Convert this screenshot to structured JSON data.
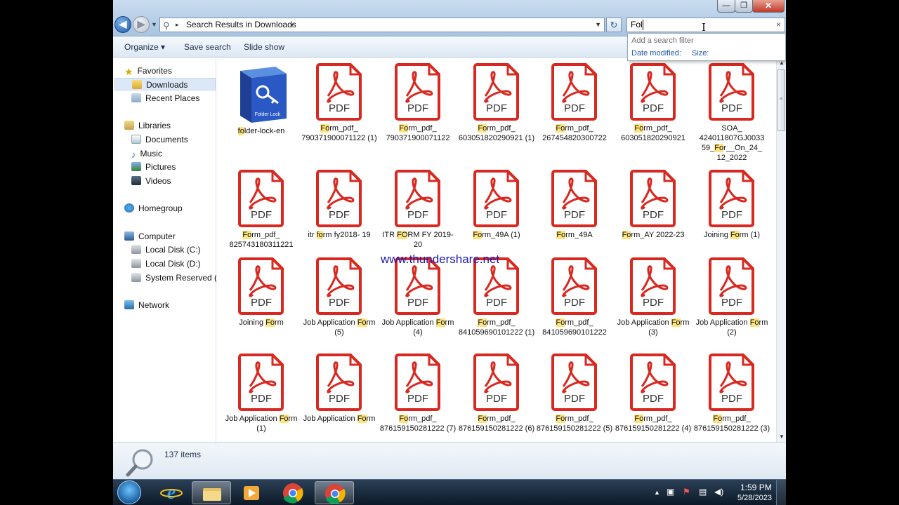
{
  "window": {
    "minimize_glyph": "—",
    "maximize_glyph": "❐",
    "close_glyph": "✕"
  },
  "address": {
    "path": "Search Results in Downloads",
    "sep": "▸"
  },
  "search": {
    "value": "Fol",
    "clear_glyph": "×"
  },
  "filter_panel": {
    "title": "Add a search filter",
    "date_label": "Date modified:",
    "size_label": "Size:"
  },
  "toolbar": {
    "organize": "Organize ▾",
    "save_search": "Save search",
    "slide_show": "Slide show"
  },
  "sidebar": {
    "favorites": "Favorites",
    "downloads": "Downloads",
    "recent_places": "Recent Places",
    "libraries": "Libraries",
    "documents": "Documents",
    "music": "Music",
    "pictures": "Pictures",
    "videos": "Videos",
    "homegroup": "Homegroup",
    "computer": "Computer",
    "local_c": "Local Disk (C:)",
    "local_d": "Local Disk (D:)",
    "system_reserved": "System Reserved (E:)",
    "network": "Network"
  },
  "icon_text": {
    "pdf": "PDF",
    "folder_lock": "Folder Lock"
  },
  "files": [
    {
      "label": "folder-lock-en",
      "hl": "fo",
      "type": "lock"
    },
    {
      "label": "Form_pdf_ 790371900071122 (1)",
      "hl": "Fo",
      "type": "pdf"
    },
    {
      "label": "Form_pdf_ 790371900071122",
      "hl": "Fo",
      "type": "pdf"
    },
    {
      "label": "Form_pdf_ 603051820290921 (1)",
      "hl": "Fo",
      "type": "pdf"
    },
    {
      "label": "Form_pdf_ 267454820300722",
      "hl": "Fo",
      "type": "pdf"
    },
    {
      "label": "Form_pdf_ 603051820290921",
      "hl": "Fo",
      "type": "pdf"
    },
    {
      "label": "SOA_ 424011807GJ0033 59_For__On_24_ 12_2022",
      "hl": "Fo",
      "type": "pdf"
    },
    {
      "label": "Form_pdf_ 825743180311221",
      "hl": "Fo",
      "type": "pdf"
    },
    {
      "label": "itr form fy2018- 19",
      "hl": "fo",
      "type": "pdf"
    },
    {
      "label": "ITR FORM FY 2019-20",
      "hl": "FO",
      "type": "pdf"
    },
    {
      "label": "Form_49A (1)",
      "hl": "Fo",
      "type": "pdf"
    },
    {
      "label": "Form_49A",
      "hl": "Fo",
      "type": "pdf"
    },
    {
      "label": "Form_AY 2022-23",
      "hl": "Fo",
      "type": "pdf"
    },
    {
      "label": "Joining Form (1)",
      "hl": "Fo",
      "type": "pdf"
    },
    {
      "label": "Joining Form",
      "hl": "Fo",
      "type": "pdf"
    },
    {
      "label": "Job Application Form (5)",
      "hl": "Fo",
      "type": "pdf"
    },
    {
      "label": "Job Application Form (4)",
      "hl": "Fo",
      "type": "pdf"
    },
    {
      "label": "Form_pdf_ 841059690101222 (1)",
      "hl": "Fo",
      "type": "pdf"
    },
    {
      "label": "Form_pdf_ 841059690101222",
      "hl": "Fo",
      "type": "pdf"
    },
    {
      "label": "Job Application Form (3)",
      "hl": "Fo",
      "type": "pdf"
    },
    {
      "label": "Job Application Form (2)",
      "hl": "Fo",
      "type": "pdf"
    },
    {
      "label": "Job Application Form (1)",
      "hl": "Fo",
      "type": "pdf"
    },
    {
      "label": "Job Application Form",
      "hl": "Fo",
      "type": "pdf"
    },
    {
      "label": "Form_pdf_ 876159150281222 (7)",
      "hl": "Fo",
      "type": "pdf"
    },
    {
      "label": "Form_pdf_ 876159150281222 (6)",
      "hl": "Fo",
      "type": "pdf"
    },
    {
      "label": "Form_pdf_ 876159150281222 (5)",
      "hl": "Fo",
      "type": "pdf"
    },
    {
      "label": "Form_pdf_ 876159150281222 (4)",
      "hl": "Fo",
      "type": "pdf"
    },
    {
      "label": "Form_pdf_ 876159150281222 (3)",
      "hl": "Fo",
      "type": "pdf"
    }
  ],
  "watermark": "www.thundershare.net",
  "status": {
    "count": "137 items"
  },
  "taskbar": {
    "time": "1:59 PM",
    "date": "5/28/2023"
  },
  "colors": {
    "pdf_red": "#d9281f",
    "highlight": "#fde47f",
    "link_blue": "#1a56a8"
  }
}
